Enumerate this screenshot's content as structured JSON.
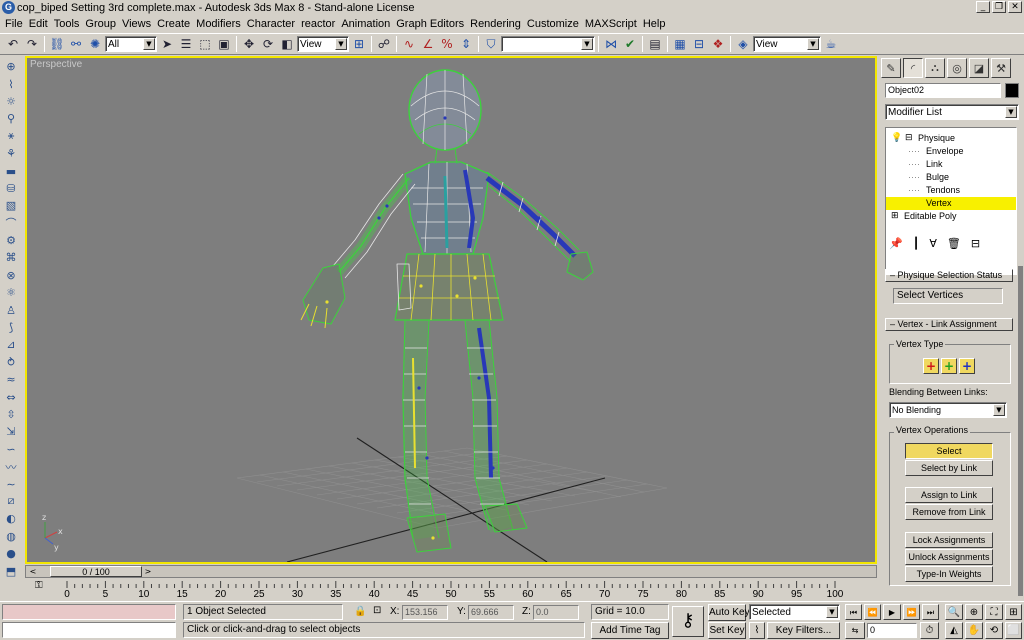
{
  "window": {
    "title": "cop_biped Setting 3rd complete.max - Autodesk 3ds Max 8 - Stand-alone License",
    "minimize": "_",
    "restore": "❐",
    "close": "✕"
  },
  "menu": [
    "File",
    "Edit",
    "Tools",
    "Group",
    "Views",
    "Create",
    "Modifiers",
    "Character",
    "reactor",
    "Animation",
    "Graph Editors",
    "Rendering",
    "Customize",
    "MAXScript",
    "Help"
  ],
  "toolbar": {
    "selection_filter": "All",
    "ref_coord": "View",
    "named_selection": "",
    "view_combo": "View"
  },
  "viewport": {
    "label": "Perspective",
    "axis_labels": {
      "x": "x",
      "y": "y",
      "z": "z"
    }
  },
  "timeslider": {
    "position": "0 / 100",
    "prev": "<",
    "next": ">"
  },
  "trackbar": {
    "ticks": [
      "0",
      "5",
      "10",
      "15",
      "20",
      "25",
      "30",
      "35",
      "40",
      "45",
      "50",
      "55",
      "60",
      "65",
      "70",
      "75",
      "80",
      "85",
      "90",
      "95",
      "100"
    ]
  },
  "status": {
    "selected": "1 Object Selected",
    "prompt": "Click or click-and-drag to select objects",
    "x_label": "X:",
    "x_value": "153.156",
    "y_label": "Y:",
    "y_value": "69.666",
    "z_label": "Z:",
    "z_value": "0.0",
    "grid": "Grid = 10.0",
    "add_time_tag": "Add Time Tag",
    "auto_key": "Auto Key",
    "set_key": "Set Key",
    "selected_combo": "Selected",
    "key_filters": "Key Filters...",
    "frame": "0"
  },
  "command_panel": {
    "object_name": "Object02",
    "modifier_list": "Modifier List",
    "stack": [
      {
        "label": "Physique",
        "indent": 1,
        "selected": false,
        "expander": "⊟"
      },
      {
        "label": "Envelope",
        "indent": 2,
        "selected": false
      },
      {
        "label": "Link",
        "indent": 2,
        "selected": false
      },
      {
        "label": "Bulge",
        "indent": 2,
        "selected": false
      },
      {
        "label": "Tendons",
        "indent": 2,
        "selected": false
      },
      {
        "label": "Vertex",
        "indent": 2,
        "selected": true
      },
      {
        "label": "Editable Poly",
        "indent": 0,
        "selected": false,
        "expander": "⊞"
      }
    ],
    "rollout_selection": "Physique Selection Status",
    "selection_status": "Select Vertices",
    "rollout_assign": "Vertex - Link Assignment",
    "vertex_type_label": "Vertex Type",
    "vertex_type_buttons": [
      "+",
      "+",
      "+"
    ],
    "vertex_type_colors": [
      "#d01818",
      "#20a020",
      "#2030c0"
    ],
    "blending_label": "Blending Between Links:",
    "blending_value": "No Blending",
    "vertex_ops_label": "Vertex Operations",
    "buttons": {
      "select": "Select",
      "select_by_link": "Select by Link",
      "assign_to_link": "Assign to Link",
      "remove_from_link": "Remove from Link",
      "lock_assignments": "Lock Assignments",
      "unlock_assignments": "Unlock Assignments",
      "type_in_weights": "Type-In Weights"
    }
  },
  "colors": {
    "viewport_bg": "#7e7e7e",
    "active_border": "#f2e600",
    "wire_green": "#3cd23c",
    "wire_white": "#e6e6e6",
    "bone_blue": "#2838b8",
    "vertex_yellow": "#e8e030"
  }
}
